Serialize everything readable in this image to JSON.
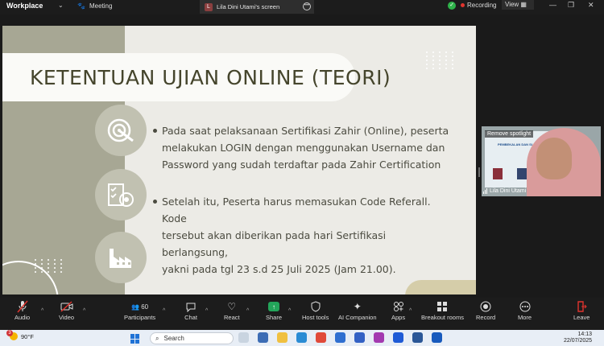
{
  "window": {
    "app_name": "Workplace",
    "meeting_tab": "Meeting",
    "screen_tab_avatar": "L",
    "screen_tab_label": "Lila Dini Utami's screen",
    "recording_label": "Recording",
    "view_label": "View"
  },
  "slide": {
    "title": "KETENTUAN UJIAN ONLINE (TEORI)",
    "bullets": [
      {
        "lines": [
          "Pada saat pelaksanaan Sertifikasi Zahir (Online), peserta",
          "melakukan LOGIN dengan menggunakan Username dan",
          "Password yang sudah terdaftar pada Zahir Certification"
        ]
      },
      {
        "lines": [
          "Setelah itu, Peserta harus memasukan Code Referall. Kode",
          "tersebut akan diberikan pada hari Sertifikasi berlangsung,",
          "yakni pada tgl 23 s.d 25 Juli 2025 (Jam 21.00)."
        ]
      }
    ],
    "icons": [
      "target-icon",
      "checklist-target-icon",
      "factory-icon"
    ],
    "colors": {
      "olive": "#a7a794",
      "background": "#ecebe6",
      "text": "#45452c"
    }
  },
  "video": {
    "spotlight_label": "Remove spotlight",
    "participant_name": "Lila Dini Utami",
    "inner_slide_title": "PEMBEKALAN DAN SI... TING"
  },
  "toolbar": {
    "audio": "Audio",
    "video": "Video",
    "participants": "Participants",
    "participants_count": "60",
    "chat": "Chat",
    "react": "React",
    "share": "Share",
    "host_tools": "Host tools",
    "ai_companion": "AI Companion",
    "apps": "Apps",
    "breakout_rooms": "Breakout rooms",
    "record": "Record",
    "more": "More",
    "leave": "Leave"
  },
  "taskbar": {
    "temperature": "90°F",
    "notification_count": "3",
    "search_placeholder": "Search",
    "time": "14:13",
    "date": "22/07/2025"
  }
}
